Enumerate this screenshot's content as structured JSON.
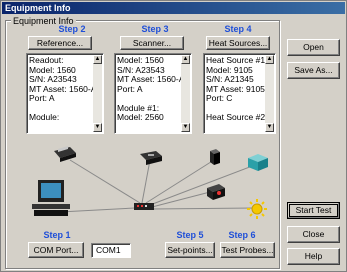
{
  "window": {
    "title": "Equipment Info"
  },
  "group": {
    "label": "Equipment Info"
  },
  "steps": {
    "s2": "Step 2",
    "s3": "Step 3",
    "s4": "Step 4",
    "s1": "Step 1",
    "s5": "Step 5",
    "s6": "Step 6"
  },
  "buttons": {
    "reference": "Reference...",
    "scanner": "Scanner...",
    "heat_sources": "Heat Sources...",
    "com_port": "COM Port...",
    "setpoints": "Set-points...",
    "test_probes": "Test Probes...",
    "open": "Open",
    "save_as": "Save As...",
    "start_test": "Start Test",
    "close": "Close",
    "help": "Help"
  },
  "com_port_value": "COM1",
  "lists": {
    "reference": [
      "Readout:",
      "Model: 1560",
      "S/N: A23543",
      "MT Asset: 1560-A",
      "Port: A",
      "",
      "Module:"
    ],
    "scanner": [
      "Model: 1560",
      "S/N: A23543",
      "MT Asset: 1560-A",
      "Port: A",
      "",
      "Module #1:",
      "Model: 2560"
    ],
    "heat": [
      "Heat Source #1:",
      "Model: 9105",
      "S/N: A21345",
      "MT Asset: 9105-A",
      "Port: C",
      "",
      "Heat Source #2:"
    ]
  },
  "icons": [
    "printer-icon",
    "scanner-icon",
    "heat-source-icon",
    "water-bath-icon",
    "computer-icon",
    "hub-icon",
    "dry-well-icon",
    "sun-icon"
  ]
}
